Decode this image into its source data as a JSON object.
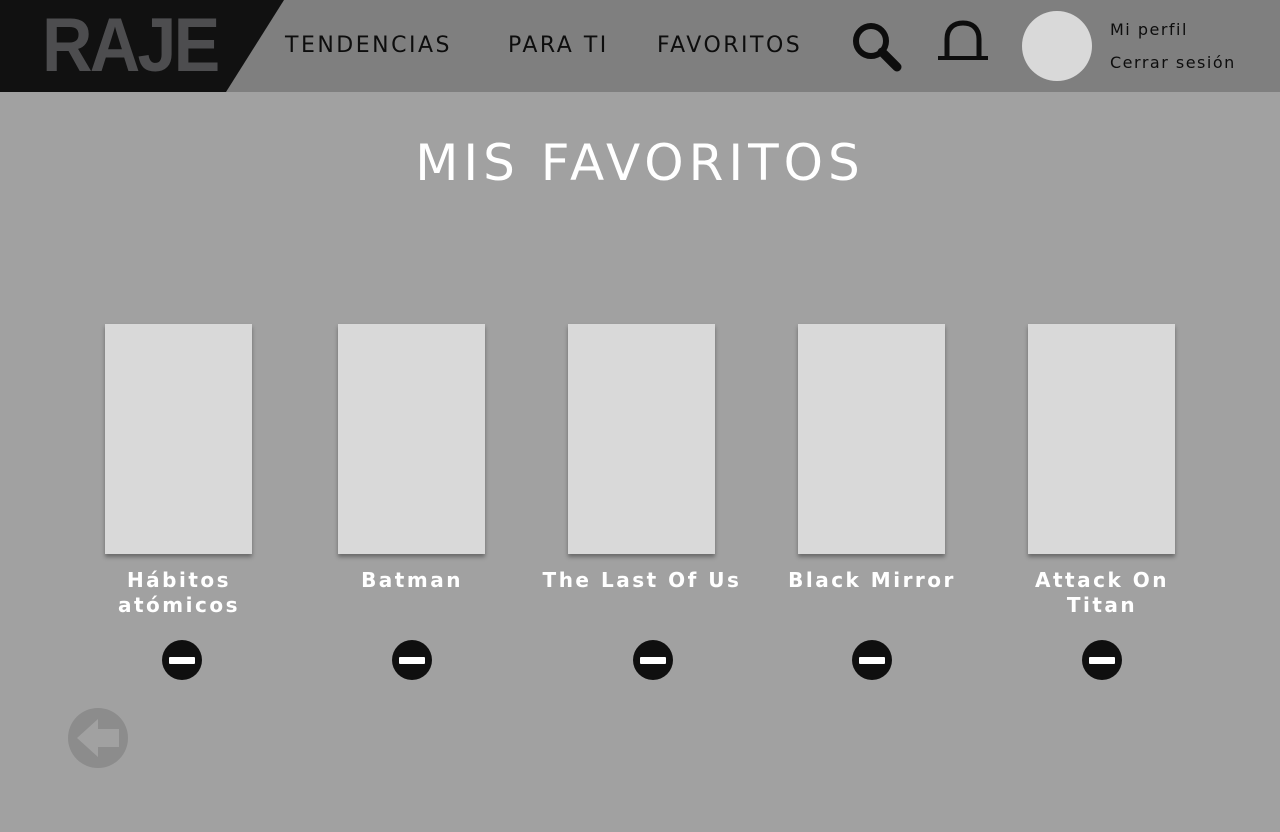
{
  "brand": {
    "logo_text": "RAJE"
  },
  "nav": {
    "trending": "TENDENCIAS",
    "for_you": "PARA TI",
    "favorites": "FAVORITOS"
  },
  "header_icons": [
    "search-icon",
    "notification-bell-icon"
  ],
  "profile": {
    "my_profile": "Mi perfil",
    "logout": "Cerrar sesión"
  },
  "page": {
    "title": "MIS FAVORITOS"
  },
  "favorites": [
    {
      "title": "Hábitos atómicos"
    },
    {
      "title": "Batman"
    },
    {
      "title": "The Last Of Us"
    },
    {
      "title": "Black Mirror"
    },
    {
      "title": "Attack On Titan"
    }
  ],
  "colors": {
    "background": "#a1a1a1",
    "header": "#7f7f7f",
    "logo_bg": "#111111",
    "logo_text": "#4d4d4f",
    "placeholder": "#d9d9d9",
    "remove_button": "#0f0f0f",
    "back_button": "#8c8c8c"
  }
}
